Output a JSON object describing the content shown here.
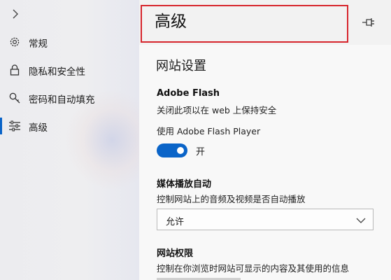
{
  "sidebar": {
    "items": [
      {
        "label": "常规",
        "icon": "gear-icon",
        "active": false
      },
      {
        "label": "隐私和安全性",
        "icon": "lock-icon",
        "active": false
      },
      {
        "label": "密码和自动填充",
        "icon": "key-icon",
        "active": false
      },
      {
        "label": "高级",
        "icon": "sliders-icon",
        "active": true
      }
    ]
  },
  "header": {
    "title": "高级",
    "highlight_color": "#d7262d"
  },
  "site_settings": {
    "heading": "网站设置",
    "flash": {
      "title": "Adobe Flash",
      "description": "关闭此项以在 web 上保持安全",
      "toggle_label": "使用 Adobe Flash Player",
      "toggle_state": "开",
      "toggle_on": true
    },
    "autoplay": {
      "title": "媒体播放自动",
      "description": "控制网站上的音频及视频是否自动播放",
      "selected": "允许"
    },
    "permissions": {
      "title": "网站权限",
      "description": "控制在你浏览时网站可显示的内容及其使用的信息"
    }
  },
  "colors": {
    "accent": "#0a64c8"
  }
}
